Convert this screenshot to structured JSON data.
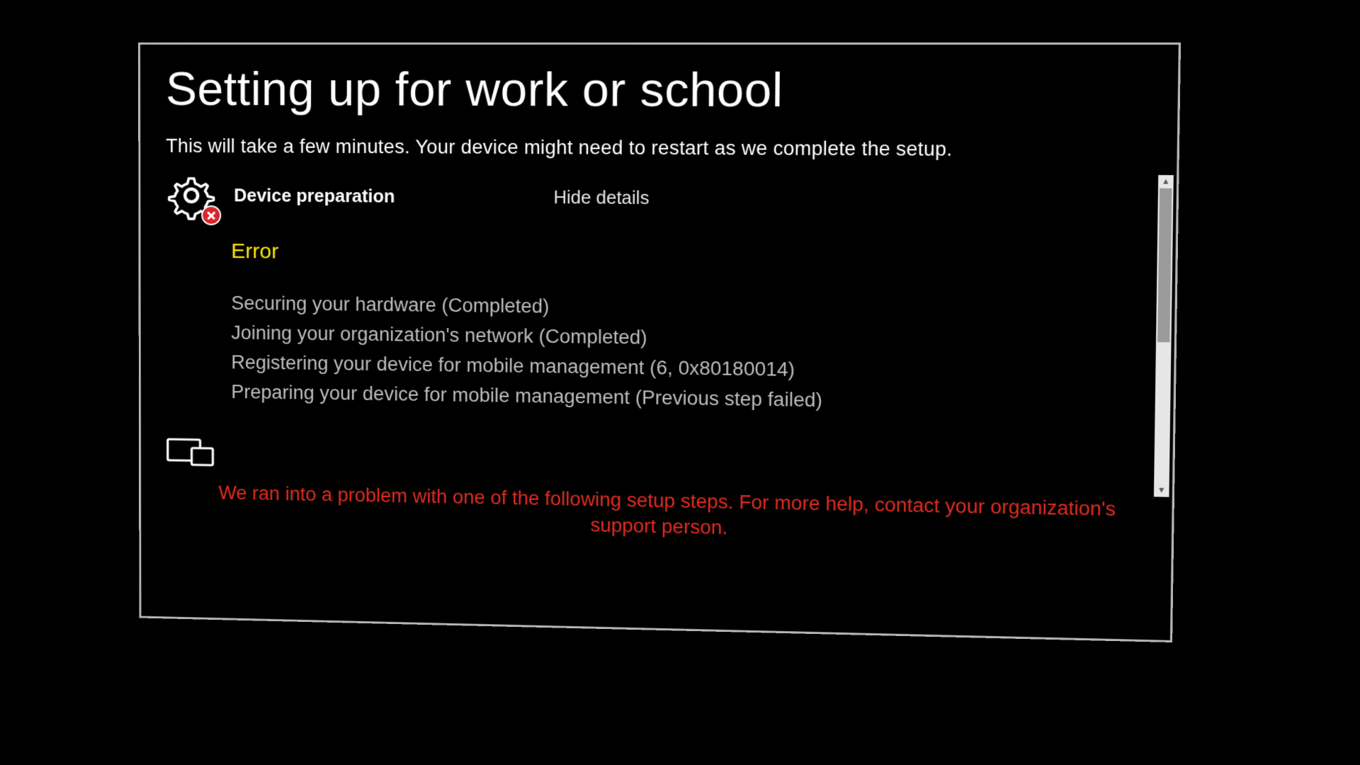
{
  "title": "Setting up for work or school",
  "subtitle": "This will take a few minutes. Your device might need to restart as we complete the setup.",
  "section": {
    "title": "Device preparation",
    "toggle_label": "Hide details",
    "status": "Error",
    "steps": [
      "Securing your hardware (Completed)",
      "Joining your organization's network (Completed)",
      "Registering your device for mobile management (6, 0x80180014)",
      "Preparing your device for mobile management (Previous step failed)"
    ]
  },
  "problem_message": "We ran into a problem with one of the following setup steps. For more help, contact your organization's support person."
}
